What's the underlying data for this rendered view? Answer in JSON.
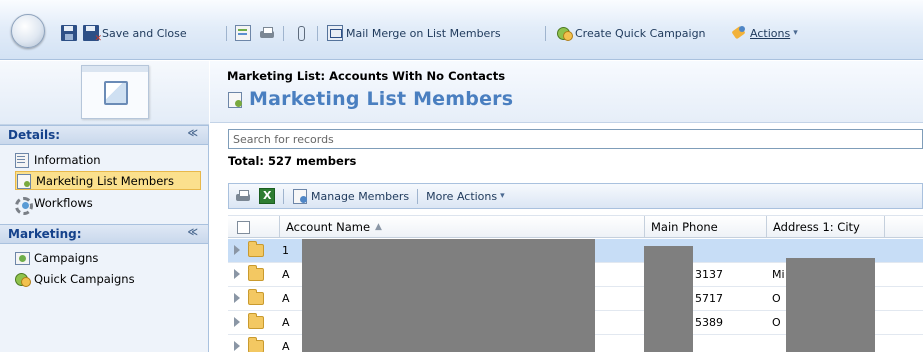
{
  "toolbar": {
    "save_and_close_label": "Save and Close",
    "mail_merge_label": "Mail Merge on List Members",
    "create_quick_campaign_label": "Create Quick Campaign",
    "actions_label": "Actions",
    "dropdown_glyph": "▾"
  },
  "left_nav": {
    "details_header": "Details:",
    "marketing_header": "Marketing:",
    "collapse_glyph": "≪",
    "details_items": [
      {
        "label": "Information",
        "icon": "information-icon"
      },
      {
        "label": "Marketing List Members",
        "icon": "list-members-icon",
        "selected": true
      },
      {
        "label": "Workflows",
        "icon": "workflow-icon"
      }
    ],
    "marketing_items": [
      {
        "label": "Campaigns",
        "icon": "campaign-icon"
      },
      {
        "label": "Quick Campaigns",
        "icon": "quick-campaign-icon"
      }
    ]
  },
  "header": {
    "breadcrumb": "Marketing List: Accounts With No Contacts",
    "title": "Marketing List Members"
  },
  "search": {
    "placeholder": "Search for records",
    "value": ""
  },
  "total_label": "Total: 527 members",
  "grid_toolbar": {
    "manage_members_label": "Manage Members",
    "more_actions_label": "More Actions"
  },
  "grid": {
    "columns": [
      "Account Name",
      "Main Phone",
      "Address 1: City"
    ],
    "sort_glyph": "▲",
    "rows": [
      {
        "name": "1",
        "phone": "",
        "city": "",
        "selected": true
      },
      {
        "name": "A",
        "phone": "3137",
        "city": "Mi"
      },
      {
        "name": "A",
        "phone": "5717",
        "city": "O"
      },
      {
        "name": "A",
        "phone": "5389",
        "city": "O"
      },
      {
        "name": "A",
        "phone": "",
        "city": ""
      }
    ]
  },
  "colors": {
    "title_blue": "#4a7fc0",
    "nav_header_text": "#15428b",
    "selected_nav_bg": "#fbe08d",
    "selected_row_bg": "#c7ddf6",
    "redaction_gray": "#7f7f7f"
  }
}
